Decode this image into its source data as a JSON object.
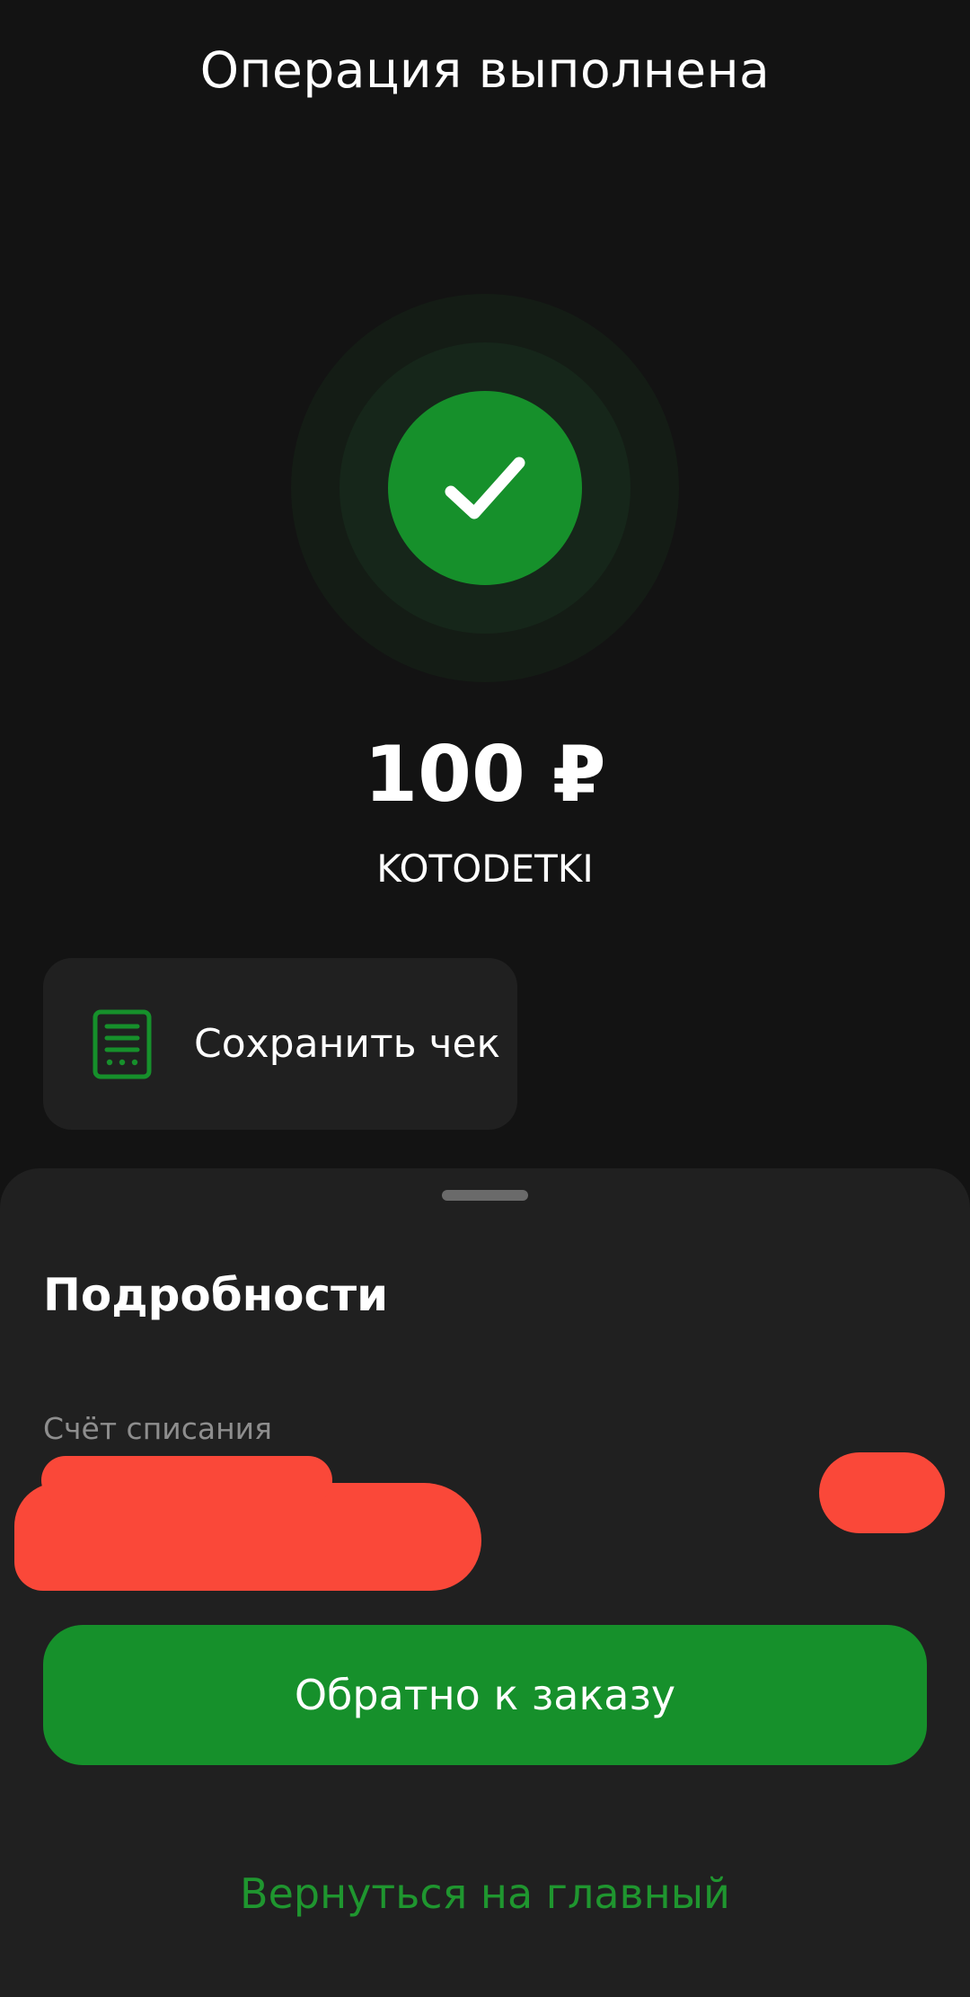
{
  "header": {
    "title": "Операция выполнена"
  },
  "status": {
    "icon": "checkmark-icon",
    "color": "#16902b"
  },
  "payment": {
    "amount": "100 ₽",
    "merchant": "KOTODETKI"
  },
  "receipt_button": {
    "label": "Сохранить чек",
    "icon": "receipt-icon",
    "icon_color": "#16902b"
  },
  "details": {
    "title": "Подробности",
    "account_label": "Счёт списания"
  },
  "actions": {
    "back_to_order": "Обратно к заказу",
    "back_to_order_color": "#16902b",
    "go_home": "Вернуться на главный",
    "go_home_color": "#1f962f"
  }
}
